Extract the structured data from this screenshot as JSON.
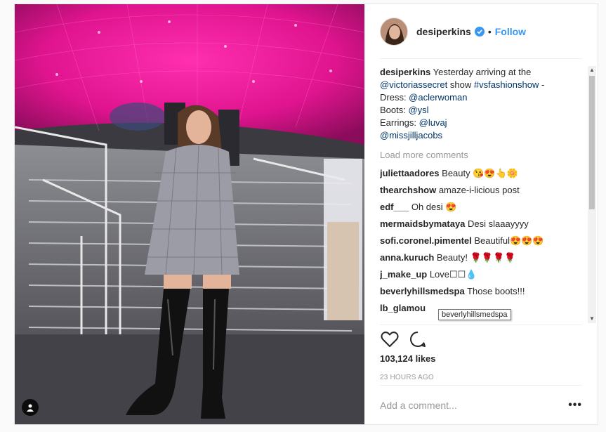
{
  "post": {
    "username": "desiperkins",
    "follow_label": "Follow",
    "separator": "•",
    "caption": {
      "username": "desiperkins",
      "text_1": " Yesterday arriving at the ",
      "link_1": "@victoriassecret",
      "text_2": " show ",
      "link_2": "#vsfashionshow",
      "text_3": " -",
      "dress_label": "Dress: ",
      "dress_link": "@aclerwoman",
      "boots_label": "Boots: ",
      "boots_link": "@ysl",
      "earrings_label": "Earrings: ",
      "earrings_link": "@luvaj",
      "jill_link": "@missjilljacobs"
    },
    "load_more": "Load more comments",
    "comments": [
      {
        "user": "juliettaadores",
        "text": "Beauty 😘😍👆🌼"
      },
      {
        "user": "thearchshow",
        "text": "amaze-i-licious post"
      },
      {
        "user": "edf___",
        "text": "Oh desi 😍"
      },
      {
        "user": "mermaidsbymataya",
        "text": "Desi slaaayyyy"
      },
      {
        "user": "sofi.coronel.pimentel",
        "text": "Beautiful😍😍😍"
      },
      {
        "user": "anna.kuruch",
        "text": "Beauty! 🌹🌹🌹🌹"
      },
      {
        "user": "j_make_up",
        "text": "Love☐☐💧"
      },
      {
        "user": "beverlyhillsmedspa",
        "text": "Those boots!!!"
      },
      {
        "user": "lb_glamou",
        "text": ""
      }
    ],
    "tooltip": "beverlyhillsmedspa",
    "likes": "103,124 likes",
    "time": "23 HOURS AGO",
    "add_comment_placeholder": "Add a comment...",
    "more_label": "•••"
  },
  "colors": {
    "link": "#003569",
    "follow": "#3897f0",
    "verified": "#3897f0"
  },
  "icons": [
    "verified-badge-icon",
    "heart-icon",
    "comment-icon",
    "person-tag-icon",
    "more-options-icon"
  ]
}
